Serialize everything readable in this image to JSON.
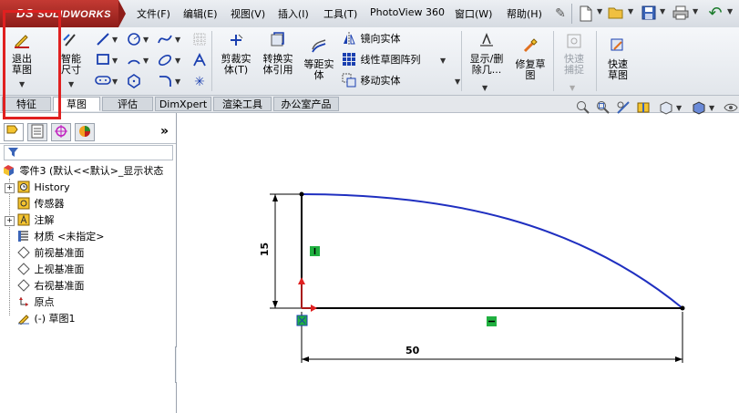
{
  "app": {
    "brand": "SOLIDWORKS",
    "brand_prefix": "DS"
  },
  "menu": [
    "文件(F)",
    "编辑(E)",
    "视图(V)",
    "插入(I)",
    "工具(T)",
    "PhotoView 360",
    "窗口(W)",
    "帮助(H)"
  ],
  "ribbon": {
    "exit_sketch": "退出草图",
    "smart_dimension": "智能尺寸",
    "trim": "剪裁实体(T)",
    "convert": "转换实体引用",
    "offset": "等距实体",
    "mirror": "镜向实体",
    "linear_pattern": "线性草图阵列",
    "move": "移动实体",
    "show_delete": "显示/删除几...",
    "repair": "修复草图",
    "quick_snap": "快速捕捉",
    "rapid_sketch": "快速草图"
  },
  "tabs": [
    "特征",
    "草图",
    "评估",
    "DimXpert",
    "渲染工具",
    "办公室产品"
  ],
  "active_tab": "草图",
  "tree": {
    "root": "零件3 (默认<<默认>_显示状态",
    "items": [
      "History",
      "传感器",
      "注解",
      "材质 <未指定>",
      "前视基准面",
      "上视基准面",
      "右视基准面",
      "原点",
      "(-) 草图1"
    ]
  },
  "sketch": {
    "dim_vertical": "15",
    "dim_horizontal": "50"
  },
  "colors": {
    "highlight": "#e02020",
    "curve": "#1f2fc0",
    "relation": "#20b040"
  }
}
